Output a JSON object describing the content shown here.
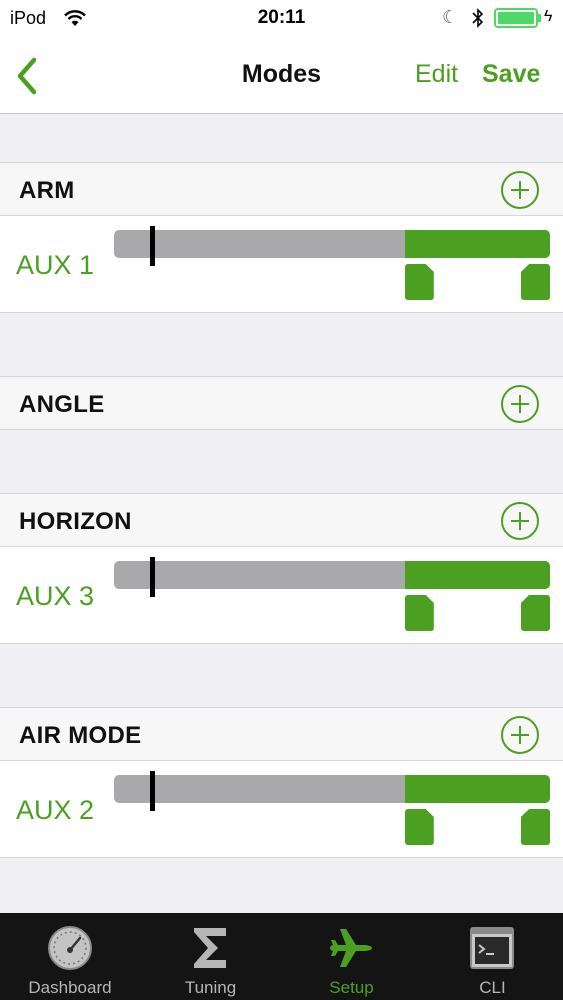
{
  "status_bar": {
    "carrier": "iPod",
    "time": "20:11"
  },
  "nav": {
    "title": "Modes",
    "edit_label": "Edit",
    "save_label": "Save"
  },
  "modes": [
    {
      "name": "ARM",
      "ranges": [
        {
          "channel": "AUX 1",
          "range_start_fraction": 0.667,
          "range_end_fraction": 1.0,
          "current_fraction": 0.083
        }
      ]
    },
    {
      "name": "ANGLE",
      "ranges": []
    },
    {
      "name": "HORIZON",
      "ranges": [
        {
          "channel": "AUX 3",
          "range_start_fraction": 0.667,
          "range_end_fraction": 1.0,
          "current_fraction": 0.083
        }
      ]
    },
    {
      "name": "AIR MODE",
      "ranges": [
        {
          "channel": "AUX 2",
          "range_start_fraction": 0.667,
          "range_end_fraction": 1.0,
          "current_fraction": 0.083
        }
      ]
    }
  ],
  "tab_bar": {
    "tabs": [
      {
        "label": "Dashboard",
        "icon": "gauge-icon",
        "active": false
      },
      {
        "label": "Tuning",
        "icon": "sigma-icon",
        "active": false
      },
      {
        "label": "Setup",
        "icon": "airplane-icon",
        "active": true
      },
      {
        "label": "CLI",
        "icon": "terminal-icon",
        "active": false
      }
    ]
  },
  "colors": {
    "accent": "#4ca021",
    "track": "#a9a9ab",
    "tab_bar_bg": "#141414",
    "tab_inactive": "#b5b5b5",
    "battery": "#4cd964"
  }
}
